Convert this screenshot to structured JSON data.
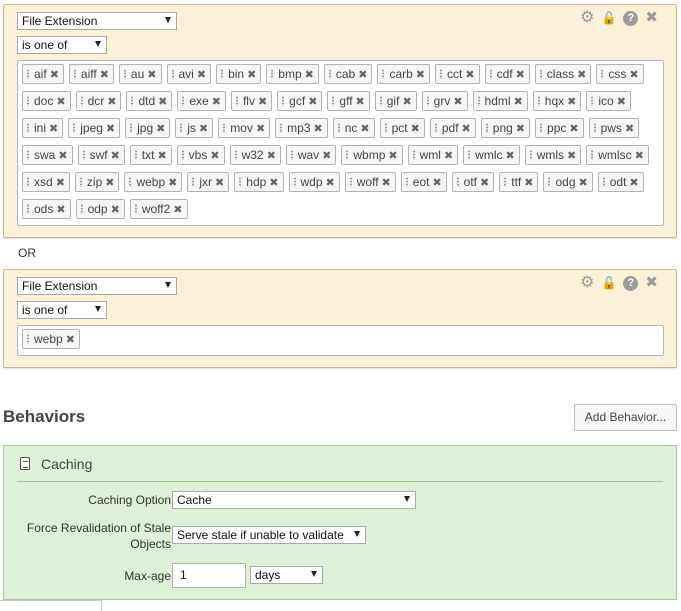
{
  "criteria": [
    {
      "field_value": "File Extension",
      "operator_value": "is one of",
      "tags": [
        "aif",
        "aiff",
        "au",
        "avi",
        "bin",
        "bmp",
        "cab",
        "carb",
        "cct",
        "cdf",
        "class",
        "css",
        "doc",
        "dcr",
        "dtd",
        "exe",
        "flv",
        "gcf",
        "gff",
        "gif",
        "grv",
        "hdml",
        "hqx",
        "ico",
        "ini",
        "jpeg",
        "jpg",
        "js",
        "mov",
        "mp3",
        "nc",
        "pct",
        "pdf",
        "png",
        "ppc",
        "pws",
        "swa",
        "swf",
        "txt",
        "vbs",
        "w32",
        "wav",
        "wbmp",
        "wml",
        "wmlc",
        "wmls",
        "wmlsc",
        "xsd",
        "zip",
        "webp",
        "jxr",
        "hdp",
        "wdp",
        "woff",
        "eot",
        "otf",
        "ttf",
        "odg",
        "odt",
        "ods",
        "odp",
        "woff2"
      ]
    },
    {
      "field_value": "File Extension",
      "operator_value": "is one of",
      "tags": [
        "webp"
      ]
    }
  ],
  "or_label": "OR",
  "icons": {
    "settings": "gear-icon",
    "lock": "lock-icon",
    "help": "help-icon",
    "close": "close-icon",
    "remove_tag": "remove-tag-icon",
    "behavior": "document-icon"
  },
  "glyphs": {
    "remove_tag": "✖",
    "help": "?",
    "close": "✖",
    "gear": "⚙",
    "lock": "🔓"
  },
  "behaviors": {
    "title": "Behaviors",
    "add_button": "Add Behavior...",
    "caching": {
      "title": "Caching",
      "option_label": "Caching Option",
      "option_value": "Cache",
      "revalidation_label_line1": "Force Revalidation of Stale",
      "revalidation_label_line2": "Objects",
      "revalidation_value": "Serve stale if unable to validate",
      "maxage_label": "Max-age",
      "maxage_value": "1",
      "maxage_unit": "days"
    }
  },
  "colors": {
    "criteria_bg": "#fbf1d8",
    "behavior_bg": "#dff0d8",
    "icon_gray": "#9b9b9b"
  }
}
